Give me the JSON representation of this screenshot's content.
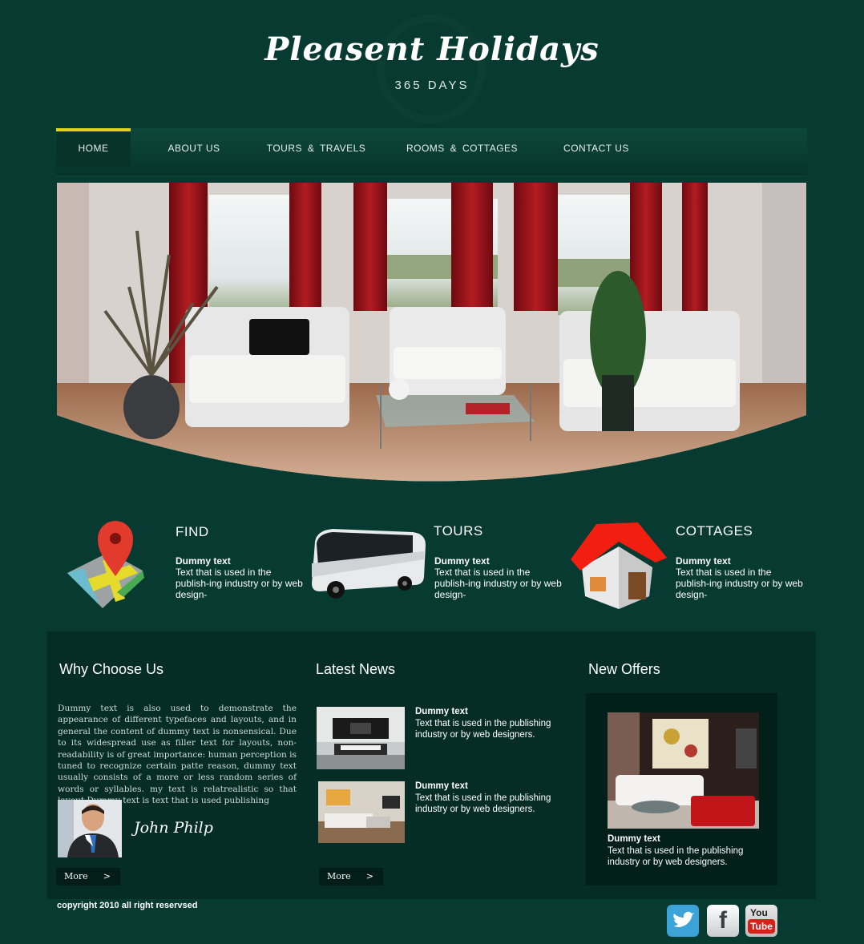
{
  "header": {
    "logo": "Pleasent Holidays",
    "tagline": "365 DAYS"
  },
  "nav": {
    "items": [
      {
        "label": "HOME",
        "active": true
      },
      {
        "label": "ABOUT US"
      },
      {
        "label": "TOURS & TRAVELS"
      },
      {
        "label": "ROOMS & COTTAGES"
      },
      {
        "label": "CONTACT US"
      }
    ]
  },
  "features": [
    {
      "title": "FIND",
      "subtitle": "Dummy text",
      "text": "Text that is used in the publish-ing industry or by web design-",
      "icon": "map-pin-icon"
    },
    {
      "title": "TOURS",
      "subtitle": "Dummy text",
      "text": "Text that is used in the publish-ing industry or by web design-",
      "icon": "bus-icon"
    },
    {
      "title": "COTTAGES",
      "subtitle": "Dummy text",
      "text": "Text that is used in the publish-ing industry or by web design-",
      "icon": "house-icon"
    }
  ],
  "why": {
    "title": "Why Choose Us",
    "text": "Dummy text is also used to demonstrate the appearance of different typefaces and layouts, and in general the content of dummy text is nonsensical. Due to its widespread use as filler text for layouts, non-readability is of great importance: human perception is tuned to recognize certain patte reason, dummy text usually consists of a more or less random series of words or syllables. my text is relatrealistic so that layout.Dummy text is text that is used publishing",
    "signature": "John Philp",
    "more": "More",
    "arrow": ">"
  },
  "news": {
    "title": "Latest News",
    "items": [
      {
        "heading": "Dummy text",
        "text": "Text that is used in the publishing industry or by web designers."
      },
      {
        "heading": "Dummy text",
        "text": "Text that is used in the publishing industry or by web designers."
      }
    ],
    "more": "More",
    "arrow": ">"
  },
  "offers": {
    "title": "New Offers",
    "heading": "Dummy text",
    "text": "Text that is used in the publishing industry or by web designers."
  },
  "footer": {
    "copyright": "copyright 2010 all right reservsed",
    "social": [
      "twitter-icon",
      "facebook-icon",
      "youtube-icon"
    ],
    "facebook_glyph": "f",
    "youtube_glyph_1": "You",
    "youtube_glyph_2": "Tube"
  },
  "colors": {
    "background": "#073a30",
    "nav_active_bar": "#e3d21b",
    "panel": "#062d25"
  }
}
